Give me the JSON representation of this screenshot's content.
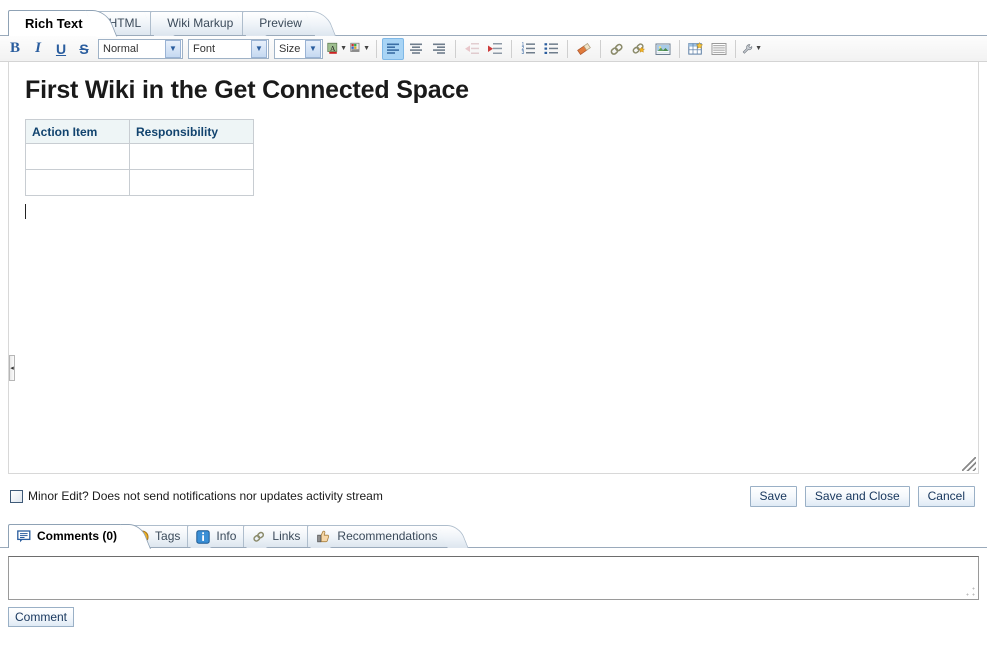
{
  "editor_tabs": [
    {
      "label": "Rich Text",
      "active": true
    },
    {
      "label": "HTML",
      "active": false
    },
    {
      "label": "Wiki Markup",
      "active": false
    },
    {
      "label": "Preview",
      "active": false
    }
  ],
  "toolbar": {
    "bold": "B",
    "italic": "I",
    "underline": "U",
    "strikethrough": "S",
    "style_select": "Normal",
    "font_select": "Font",
    "size_select": "Size"
  },
  "document": {
    "title": "First Wiki in the Get Connected Space",
    "table": {
      "headers": [
        "Action Item",
        "Responsibility"
      ],
      "rows": [
        [
          "",
          ""
        ],
        [
          "",
          ""
        ]
      ]
    }
  },
  "actions": {
    "minor_edit_label": "Minor Edit? Does not send notifications nor updates activity stream",
    "save": "Save",
    "save_and_close": "Save and Close",
    "cancel": "Cancel"
  },
  "bottom_tabs": [
    {
      "label": "Comments (0)",
      "active": true
    },
    {
      "label": "Tags",
      "active": false
    },
    {
      "label": "Info",
      "active": false
    },
    {
      "label": "Links",
      "active": false
    },
    {
      "label": "Recommendations",
      "active": false
    }
  ],
  "comment": {
    "value": "",
    "button": "Comment"
  },
  "colors": {
    "accent": "#2a5d9e",
    "table_header_text": "#11436e",
    "table_header_bg": "#eef5f6",
    "active_tool_bg": "#a8d4f5"
  }
}
